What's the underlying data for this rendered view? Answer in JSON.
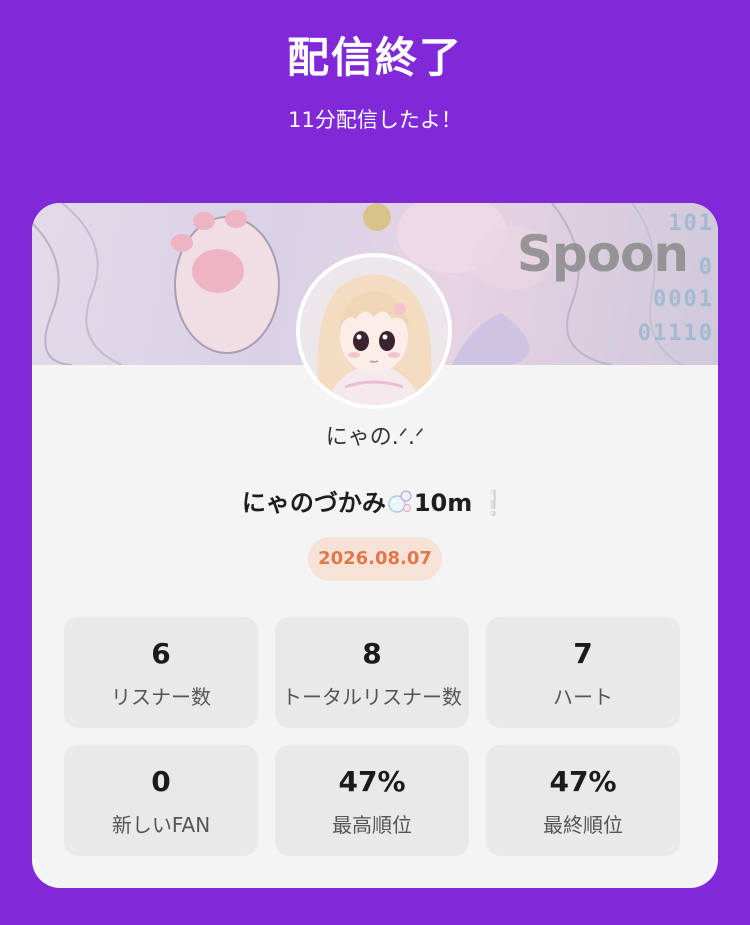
{
  "header": {
    "title": "配信終了",
    "subtitle": "11分配信したよ！"
  },
  "card": {
    "banner": {
      "brand_text": "Spoon",
      "binary_lines": [
        "101",
        "0",
        "0001",
        "01110"
      ]
    },
    "avatar_icon": "anime-girl-avatar",
    "username": "にゃの.ᐟ.ᐟ",
    "stream_title": {
      "text": "にゃのづかみ",
      "emoji_icon": "bubbles-icon",
      "suffix": "10m",
      "excl": "❕"
    },
    "date": "2026.08.07",
    "stats": [
      {
        "value": "6",
        "label": "リスナー数"
      },
      {
        "value": "8",
        "label": "トータルリスナー数"
      },
      {
        "value": "7",
        "label": "ハート"
      },
      {
        "value": "0",
        "label": "新しいFAN"
      },
      {
        "value": "47%",
        "label": "最高順位"
      },
      {
        "value": "47%",
        "label": "最終順位"
      }
    ]
  },
  "colors": {
    "background": "#8129d9",
    "card": "#f4f4f4",
    "stat_tile": "#e9e9e9",
    "date_badge_bg": "#f6e2d7",
    "date_badge_text": "#e0784a"
  }
}
